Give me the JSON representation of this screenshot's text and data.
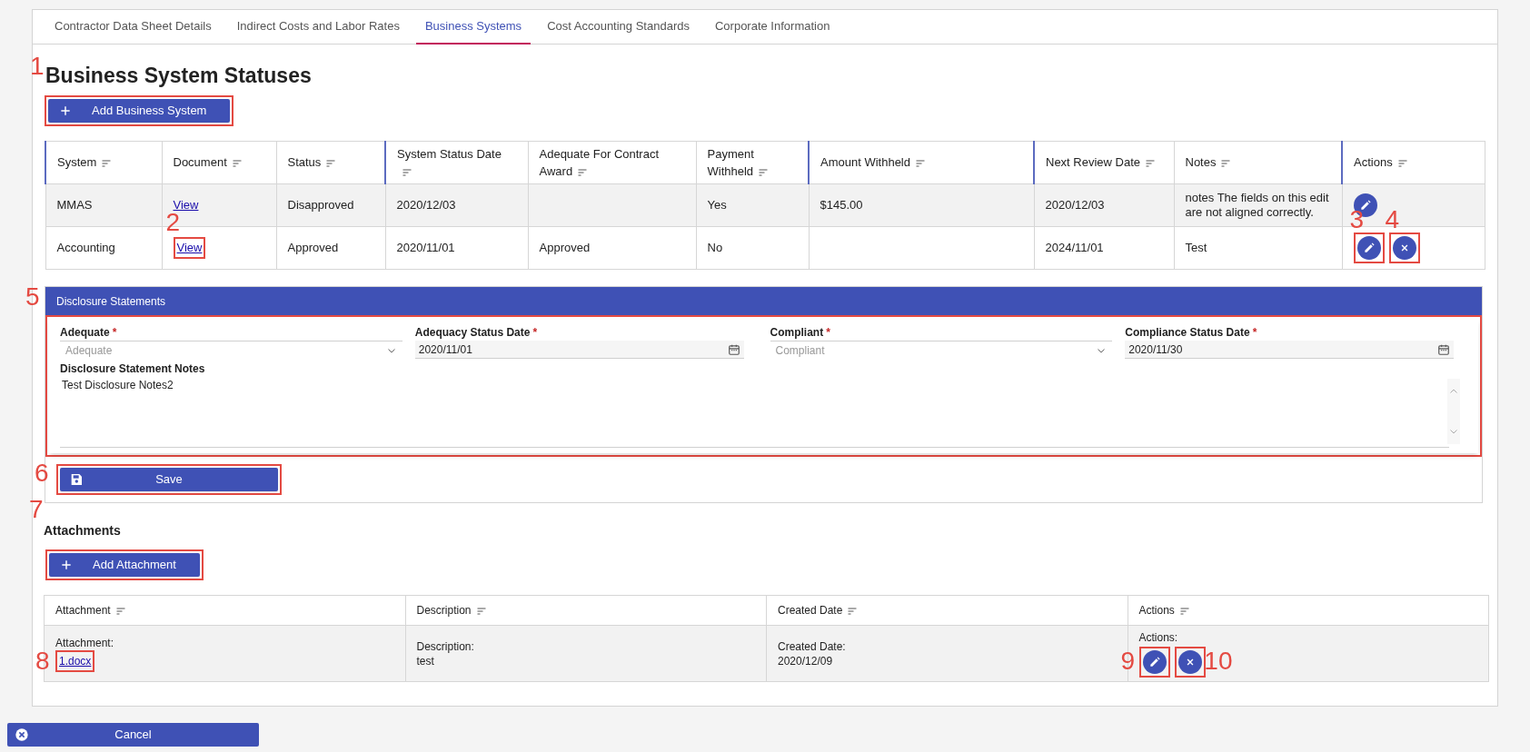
{
  "tabs": [
    {
      "label": "Contractor Data Sheet Details",
      "selected": false
    },
    {
      "label": "Indirect Costs and Labor Rates",
      "selected": false
    },
    {
      "label": "Business Systems",
      "selected": true
    },
    {
      "label": "Cost Accounting Standards",
      "selected": false
    },
    {
      "label": "Corporate Information",
      "selected": false
    }
  ],
  "heading": {
    "text": "Business System Statuses"
  },
  "add_business_system": {
    "label": "Add Business System",
    "callout": "1"
  },
  "systems_table": {
    "columns": [
      {
        "label": "System",
        "kind": "text"
      },
      {
        "label": "Document",
        "kind": "link"
      },
      {
        "label": "Status",
        "kind": "text"
      },
      {
        "label": "System Status Date",
        "kind": "text"
      },
      {
        "label": "Adequate For Contract Award",
        "kind": "text"
      },
      {
        "label": "Payment Withheld",
        "kind": "text"
      },
      {
        "label": "Amount Withheld",
        "kind": "text"
      },
      {
        "label": "Next Review Date",
        "kind": "text"
      },
      {
        "label": "Notes",
        "kind": "text"
      },
      {
        "label": "Actions",
        "kind": "actions"
      }
    ],
    "rows": [
      {
        "cells": [
          {
            "text": "MMAS"
          },
          {
            "text": "View"
          },
          {
            "text": "Disapproved"
          },
          {
            "text": "2020/12/03"
          },
          {},
          {
            "text": "Yes"
          },
          {
            "text": "$145.00"
          },
          {
            "text": "2020/12/03"
          },
          {
            "text": "notes The fields on this edit are not aligned correctly."
          },
          {
            "actions": [
              {
                "kind": "edit"
              }
            ]
          }
        ]
      },
      {
        "cells": [
          {
            "text": "Accounting"
          },
          {
            "text": "View",
            "callout": "2"
          },
          {
            "text": "Approved"
          },
          {
            "text": "2020/11/01"
          },
          {
            "text": "Approved"
          },
          {
            "text": "No"
          },
          {},
          {
            "text": "2024/11/01"
          },
          {
            "text": "Test"
          },
          {
            "actions": [
              {
                "kind": "edit",
                "callout": "3"
              },
              {
                "kind": "delete",
                "callout": "4"
              }
            ]
          }
        ]
      }
    ]
  },
  "disclosure": {
    "title": "Disclosure Statements",
    "callout": "5",
    "fields": [
      {
        "label": "Adequate",
        "required_mark": "*",
        "kind": "select",
        "placeholder": "Adequate"
      },
      {
        "label": "Adequacy Status Date",
        "required_mark": "*",
        "kind": "date",
        "value": "2020/11/01"
      },
      {
        "label": "Compliant",
        "required_mark": "*",
        "kind": "select",
        "placeholder": "Compliant"
      },
      {
        "label": "Compliance Status Date",
        "required_mark": "*",
        "kind": "date",
        "value": "2020/11/30"
      }
    ],
    "notes": {
      "label": "Disclosure Statement Notes",
      "value": "Test Disclosure Notes2"
    },
    "save_button": {
      "label": "Save",
      "callout": "6"
    }
  },
  "attachments": {
    "title": "Attachments",
    "callout": "7",
    "add_button": {
      "label": "Add Attachment"
    },
    "columns": [
      {
        "label": "Attachment",
        "kind": "link"
      },
      {
        "label": "Description",
        "kind": "text"
      },
      {
        "label": "Created Date",
        "kind": "text"
      },
      {
        "label": "Actions",
        "kind": "actions"
      }
    ],
    "rows": [
      {
        "cells": [
          {
            "label": "Attachment:",
            "text": "1.docx",
            "callout": "8"
          },
          {
            "label": "Description:",
            "text": "test"
          },
          {
            "label": "Created Date:",
            "text": "2020/12/09"
          },
          {
            "label": "Actions:",
            "actions": [
              {
                "kind": "edit",
                "callout": "9"
              },
              {
                "kind": "delete",
                "callout": "10"
              }
            ]
          }
        ]
      }
    ]
  },
  "cancel_button": {
    "label": "Cancel"
  }
}
